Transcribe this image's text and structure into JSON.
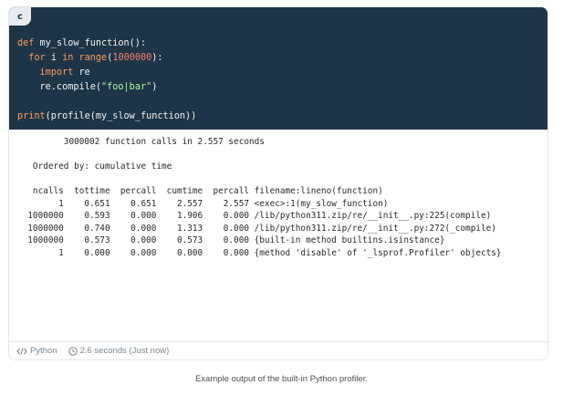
{
  "language_badge": "c",
  "code_lines": [
    [
      {
        "t": "def",
        "c": "kw"
      },
      {
        "t": " my_slow_function():",
        "c": ""
      }
    ],
    [
      {
        "t": "  ",
        "c": ""
      },
      {
        "t": "for",
        "c": "kw"
      },
      {
        "t": " i ",
        "c": ""
      },
      {
        "t": "in",
        "c": "kw"
      },
      {
        "t": " ",
        "c": ""
      },
      {
        "t": "range",
        "c": "kw"
      },
      {
        "t": "(",
        "c": ""
      },
      {
        "t": "1000000",
        "c": "num"
      },
      {
        "t": "):",
        "c": ""
      }
    ],
    [
      {
        "t": "    ",
        "c": ""
      },
      {
        "t": "import",
        "c": "kw"
      },
      {
        "t": " re",
        "c": ""
      }
    ],
    [
      {
        "t": "    re.compile(",
        "c": ""
      },
      {
        "t": "\"foo|bar\"",
        "c": "str"
      },
      {
        "t": ")",
        "c": ""
      }
    ],
    [
      {
        "t": "",
        "c": ""
      }
    ],
    [
      {
        "t": "print",
        "c": "kw"
      },
      {
        "t": "(profile(my_slow_function))",
        "c": ""
      }
    ]
  ],
  "output_lines": [
    "         3000002 function calls in 2.557 seconds",
    "",
    "   Ordered by: cumulative time",
    "",
    "   ncalls  tottime  percall  cumtime  percall filename:lineno(function)",
    "        1    0.651    0.651    2.557    2.557 <exec>:1(my_slow_function)",
    "  1000000    0.593    0.000    1.906    0.000 /lib/python311.zip/re/__init__.py:225(compile)",
    "  1000000    0.740    0.000    1.313    0.000 /lib/python311.zip/re/__init__.py:272(_compile)",
    "  1000000    0.573    0.000    0.573    0.000 {built-in method builtins.isinstance}",
    "        1    0.000    0.000    0.000    0.000 {method 'disable' of '_lsprof.Profiler' objects}"
  ],
  "footer": {
    "language": "Python",
    "runtime": "2.6 seconds (Just now)"
  },
  "icons": {
    "language": "code-icon",
    "runtime": "clock-icon"
  },
  "caption": "Example output of the built-in Python profiler."
}
